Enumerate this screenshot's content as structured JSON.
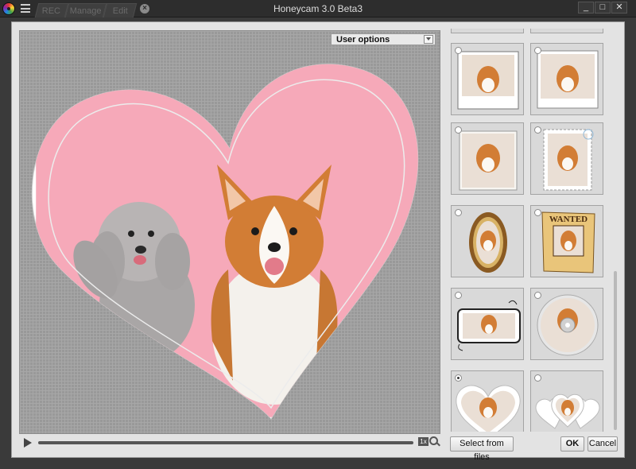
{
  "window": {
    "title": "Honeycam 3.0 Beta3",
    "controls": [
      "_",
      "□",
      "✕"
    ]
  },
  "tabs": [
    {
      "label": "REC"
    },
    {
      "label": "Manage"
    },
    {
      "label": "Edit"
    }
  ],
  "tab_close_symbol": "⊗",
  "preview": {
    "user_options_label": "User options",
    "speed_label": "1x",
    "frame_border_color": "#ffffff",
    "background_color": "#f6a9b9"
  },
  "frame_panel": {
    "items": [
      {
        "style": "polaroid-white",
        "selected": false
      },
      {
        "style": "polaroid-white",
        "selected": false
      },
      {
        "style": "photo-print",
        "selected": false
      },
      {
        "style": "stamp",
        "selected": false
      },
      {
        "style": "ornate-oval-gold",
        "selected": false
      },
      {
        "style": "wanted-poster",
        "text": "WANTED",
        "selected": false
      },
      {
        "style": "cartoon-speech",
        "selected": false
      },
      {
        "style": "cd-disc",
        "selected": false
      },
      {
        "style": "heart",
        "selected": true
      },
      {
        "style": "double-heart",
        "selected": false
      }
    ]
  },
  "buttons": {
    "select_from_files": "Select from files",
    "ok": "OK",
    "cancel": "Cancel"
  }
}
